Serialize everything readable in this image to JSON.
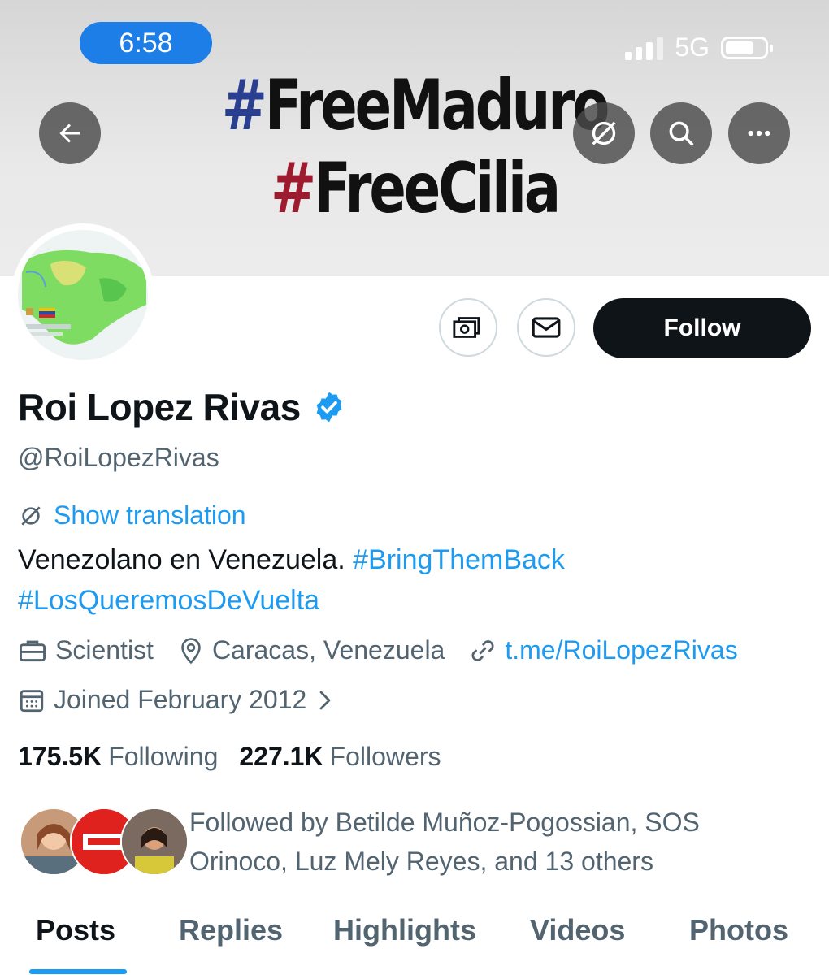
{
  "status_bar": {
    "time": "6:58",
    "network": "5G"
  },
  "banner": {
    "line1_hash": "#",
    "line1_text": "FreeMaduro",
    "line2_hash": "#",
    "line2_text": "FreeCilia"
  },
  "header_icons": [
    "back-arrow-icon",
    "translate-icon",
    "search-icon",
    "more-icon"
  ],
  "actions": {
    "follow_label": "Follow"
  },
  "profile": {
    "name": "Roi Lopez Rivas",
    "verified": true,
    "handle": "@RoiLopezRivas",
    "show_translation": "Show translation",
    "bio_text": "Venezolano en Venezuela. ",
    "bio_tag1": "#BringThemBack",
    "bio_tag2": "#LosQueremosDeVuelta",
    "profession": "Scientist",
    "location": "Caracas, Venezuela",
    "website": "t.me/RoiLopezRivas",
    "joined": "Joined February 2012"
  },
  "stats": {
    "following_count": "175.5K",
    "following_label": "Following",
    "followers_count": "227.1K",
    "followers_label": "Followers"
  },
  "followed_by": "Followed by Betilde Muñoz-Pogossian, SOS Orinoco, Luz Mely Reyes, and 13 others",
  "tabs": [
    "Posts",
    "Replies",
    "Highlights",
    "Videos",
    "Photos"
  ],
  "active_tab": "Posts",
  "colors": {
    "accent": "#1d9bf0",
    "text": "#0f1419",
    "muted": "#536471",
    "follow_bg": "#0f1419"
  }
}
